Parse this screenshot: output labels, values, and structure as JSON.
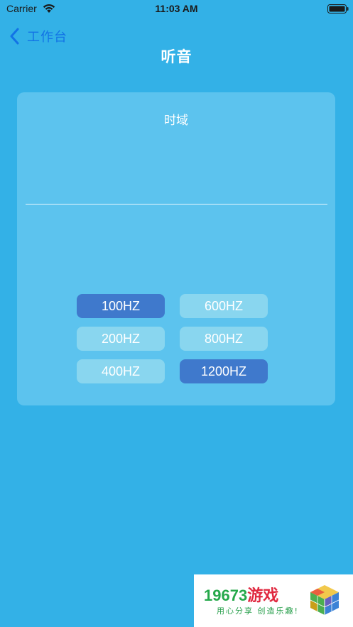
{
  "status_bar": {
    "carrier": "Carrier",
    "time": "11:03 AM",
    "wifi_icon": "wifi-icon",
    "battery_icon": "battery-icon"
  },
  "nav": {
    "back_label": "工作台",
    "back_icon": "chevron-left-icon",
    "title": "听音"
  },
  "card": {
    "title": "时域",
    "buttons": [
      {
        "label": "100HZ",
        "selected": true
      },
      {
        "label": "600HZ",
        "selected": false
      },
      {
        "label": "200HZ",
        "selected": false
      },
      {
        "label": "800HZ",
        "selected": false
      },
      {
        "label": "400HZ",
        "selected": false
      },
      {
        "label": "1200HZ",
        "selected": true
      }
    ]
  },
  "watermark": {
    "brand_number": "19673",
    "brand_cn": "游戏",
    "slogan": "用心分享 创造乐趣!"
  },
  "colors": {
    "background": "#33b1e7",
    "card": "#5cc3ee",
    "button_active": "#3f79cc",
    "button_inactive": "#89d6ef",
    "back_link": "#1273e6"
  }
}
